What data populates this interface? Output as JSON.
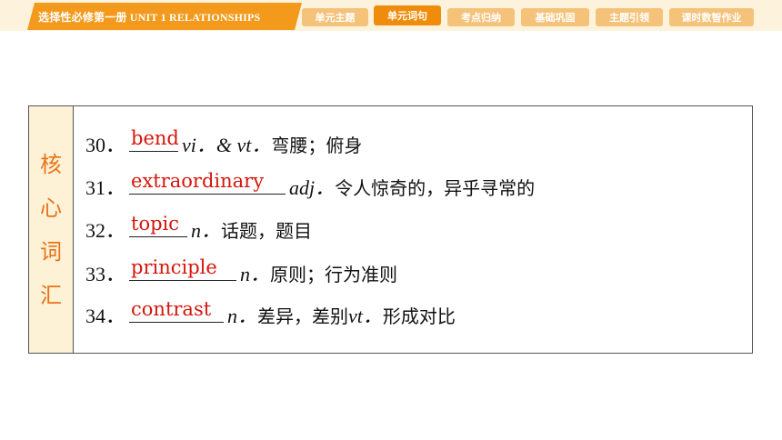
{
  "header": {
    "title": "选择性必修第一册   UNIT 1   RELATIONSHIPS",
    "tabs": [
      {
        "label": "单元主题",
        "active": false
      },
      {
        "label": "单元词句",
        "active": true
      },
      {
        "label": "考点归纳",
        "active": false
      },
      {
        "label": "基础巩固",
        "active": false
      },
      {
        "label": "主题引领",
        "active": false
      },
      {
        "label": "课时数智作业",
        "active": false
      }
    ]
  },
  "sidebar": {
    "chars": [
      "核",
      "心",
      "词",
      "汇"
    ]
  },
  "items": [
    {
      "num": "30．",
      "answer": "bend",
      "pos": "vi．& vt．",
      "meaning": "弯腰；俯身"
    },
    {
      "num": "31．",
      "answer": "extraordinary",
      "pos": "adj．",
      "meaning": "令人惊奇的，异乎寻常的"
    },
    {
      "num": "32．",
      "answer": "topic",
      "pos": "n．",
      "meaning": "话题，题目"
    },
    {
      "num": "33．",
      "answer": "principle",
      "pos": "n．",
      "meaning": "原则；行为准则"
    },
    {
      "num": "34．",
      "answer": "contrast",
      "pos": "n．",
      "meaning": "差异，差别",
      "pos2": "vt．",
      "meaning2": "形成对比"
    }
  ],
  "colors": {
    "accent": "#f39a1c",
    "answer": "#d4160b",
    "side_text": "#e8731a"
  }
}
